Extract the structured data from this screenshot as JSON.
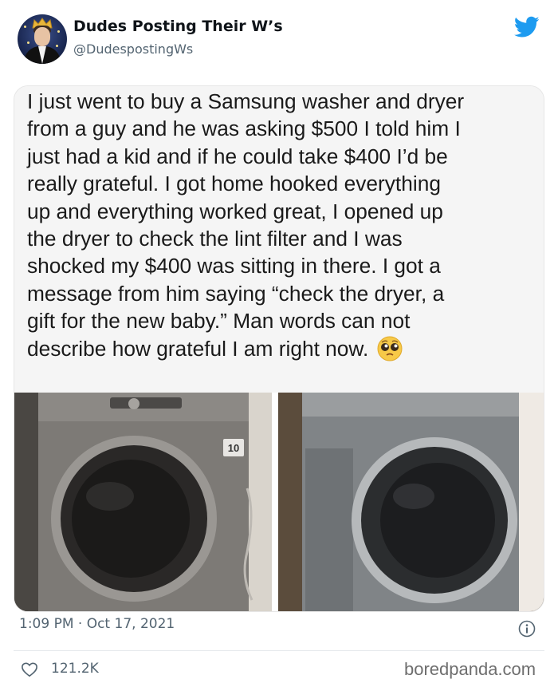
{
  "tweet": {
    "display_name": "Dudes Posting Their W’s",
    "handle": "@DudespostingWs",
    "timestamp": "1:09 PM · Oct 17, 2021",
    "likes": "121.2K"
  },
  "screenshot_post": {
    "lines": [
      "I just went to buy a Samsung washer and dryer",
      "from a guy and he was asking $500 I told him I",
      "just had a kid and if he could take $400 I’d be",
      "really grateful. I got home hooked everything",
      "up and everything worked great, I opened up",
      "the dryer to check the lint filter and I was",
      "shocked my $400 was sitting in there. I got a",
      "message from him saying “check the dryer, a",
      "gift for the new baby.” Man words can not",
      "describe how grateful I am right now."
    ],
    "emoji": "pleading-face-emoji"
  },
  "photos": {
    "left_badge": "10"
  },
  "icons": {
    "brand": "twitter-bird-icon",
    "info": "info-icon",
    "like": "heart-icon"
  },
  "colors": {
    "twitter_blue": "#1d9bf0",
    "secondary_text": "#536471"
  },
  "watermark": "boredpanda.com"
}
